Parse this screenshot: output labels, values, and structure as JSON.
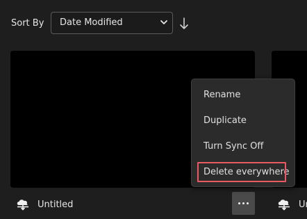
{
  "sort": {
    "label": "Sort By",
    "selected": "Date Modified",
    "direction_icon": "arrow-down-icon"
  },
  "cards": [
    {
      "title": "Untitled",
      "sync_icon": "cloud-sync-icon"
    },
    {
      "title": "Un",
      "sync_icon": "cloud-sync-icon"
    }
  ],
  "menu": {
    "items": [
      {
        "label": "Rename"
      },
      {
        "label": "Duplicate"
      },
      {
        "label": "Turn Sync Off"
      },
      {
        "label": "Delete everywhere",
        "highlighted": true
      }
    ]
  },
  "colors": {
    "background": "#1e1e1e",
    "menu_bg": "#2b2b2b",
    "highlight": "#e85a5f",
    "more_button_bg": "#4a4a4a"
  }
}
